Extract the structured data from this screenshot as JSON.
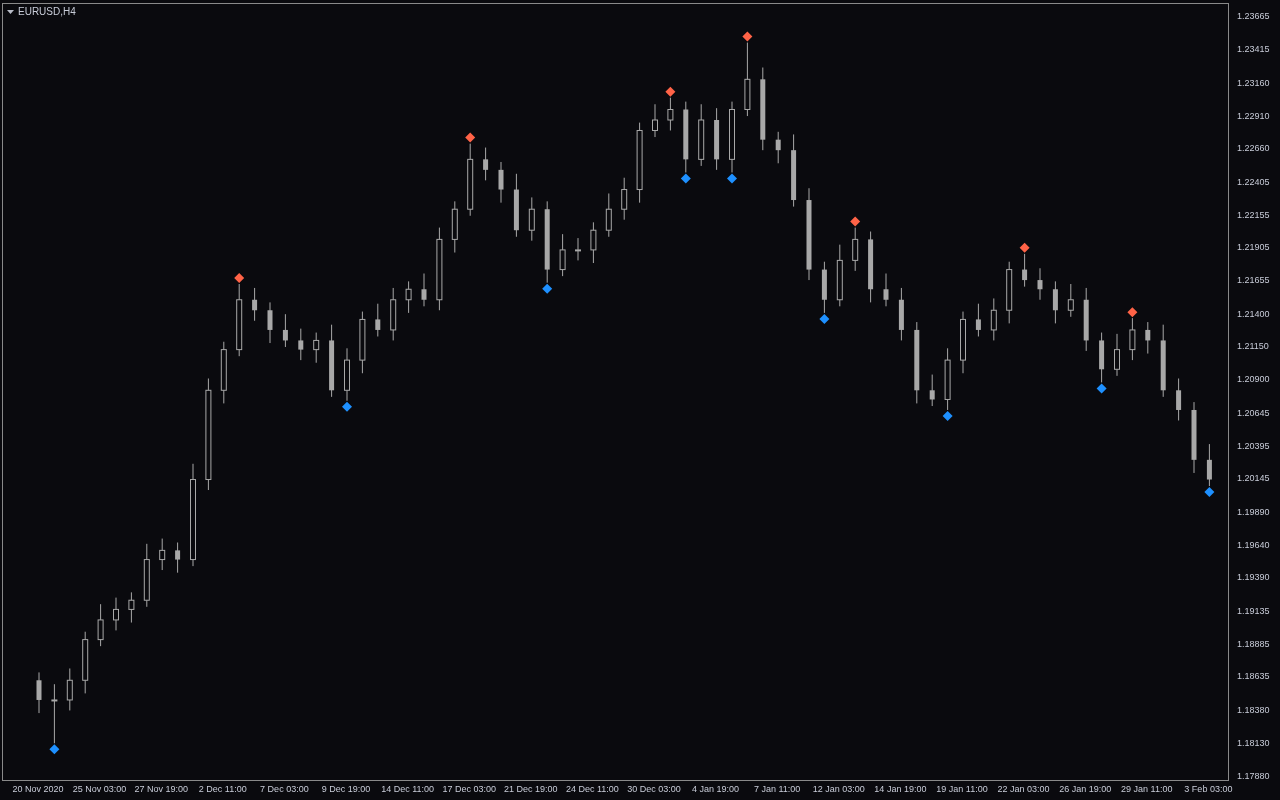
{
  "chart": {
    "chart_data": {
      "type": "candlestick",
      "title": "EURUSD,H4",
      "ylim": [
        1.1785,
        1.23764
      ],
      "yticks": [
        {
          "value": 1.23665,
          "label": "1.23665"
        },
        {
          "value": 1.23415,
          "label": "1.23415"
        },
        {
          "value": 1.2316,
          "label": "1.23160"
        },
        {
          "value": 1.2291,
          "label": "1.22910"
        },
        {
          "value": 1.2266,
          "label": "1.22660"
        },
        {
          "value": 1.22405,
          "label": "1.22405"
        },
        {
          "value": 1.22155,
          "label": "1.22155"
        },
        {
          "value": 1.21905,
          "label": "1.21905"
        },
        {
          "value": 1.21655,
          "label": "1.21655"
        },
        {
          "value": 1.214,
          "label": "1.21400"
        },
        {
          "value": 1.2115,
          "label": "1.21150"
        },
        {
          "value": 1.209,
          "label": "1.20900"
        },
        {
          "value": 1.20645,
          "label": "1.20645"
        },
        {
          "value": 1.20395,
          "label": "1.20395"
        },
        {
          "value": 1.20145,
          "label": "1.20145"
        },
        {
          "value": 1.1989,
          "label": "1.19890"
        },
        {
          "value": 1.1964,
          "label": "1.19640"
        },
        {
          "value": 1.1939,
          "label": "1.19390"
        },
        {
          "value": 1.19135,
          "label": "1.19135"
        },
        {
          "value": 1.18885,
          "label": "1.18885"
        },
        {
          "value": 1.18635,
          "label": "1.18635"
        },
        {
          "value": 1.1838,
          "label": "1.18380"
        },
        {
          "value": 1.1813,
          "label": "1.18130"
        },
        {
          "value": 1.1788,
          "label": "1.17880"
        }
      ],
      "categories": [
        "20 Nov 2020",
        null,
        null,
        null,
        "25 Nov 03:00",
        null,
        null,
        null,
        "27 Nov 19:00",
        null,
        null,
        null,
        "2 Dec 11:00",
        null,
        null,
        null,
        "7 Dec 03:00",
        null,
        null,
        null,
        "9 Dec 19:00",
        null,
        null,
        null,
        "14 Dec 11:00",
        null,
        null,
        null,
        "17 Dec 03:00",
        null,
        null,
        null,
        "21 Dec 19:00",
        null,
        null,
        null,
        "24 Dec 11:00",
        null,
        null,
        null,
        "30 Dec 03:00",
        null,
        null,
        null,
        "4 Jan 19:00",
        null,
        null,
        null,
        "7 Jan 11:00",
        null,
        null,
        null,
        "12 Jan 03:00",
        null,
        null,
        null,
        "14 Jan 19:00",
        null,
        null,
        null,
        "19 Jan 11:00",
        null,
        null,
        null,
        "22 Jan 03:00",
        null,
        null,
        null,
        "26 Jan 19:00",
        null,
        null,
        null,
        "29 Jan 11:00",
        null,
        null,
        null,
        "3 Feb 03:00"
      ],
      "series": [
        {
          "color": "#a8a8a8",
          "ohlc": [
            [
              1.1861,
              1.1867,
              1.1836,
              1.1846
            ],
            [
              1.1846,
              1.1858,
              1.1813,
              1.1846
            ],
            [
              1.1846,
              1.187,
              1.1838,
              1.1861
            ],
            [
              1.1861,
              1.1898,
              1.1851,
              1.1892
            ],
            [
              1.1892,
              1.1919,
              1.1887,
              1.1907
            ],
            [
              1.1907,
              1.1924,
              1.1899,
              1.1915
            ],
            [
              1.1915,
              1.1928,
              1.1905,
              1.1922
            ],
            [
              1.1922,
              1.1965,
              1.1917,
              1.1953
            ],
            [
              1.1953,
              1.1969,
              1.1945,
              1.196
            ],
            [
              1.196,
              1.1966,
              1.1943,
              1.1953
            ],
            [
              1.1953,
              1.2026,
              1.1948,
              1.2014
            ],
            [
              1.2014,
              1.2091,
              1.2006,
              1.2082
            ],
            [
              1.2082,
              1.2119,
              1.2072,
              1.2113
            ],
            [
              1.2113,
              1.2163,
              1.2108,
              1.2151
            ],
            [
              1.2151,
              1.216,
              1.2135,
              1.2143
            ],
            [
              1.2143,
              1.2149,
              1.2118,
              1.2128
            ],
            [
              1.2128,
              1.214,
              1.2115,
              1.212
            ],
            [
              1.212,
              1.2129,
              1.2105,
              1.2113
            ],
            [
              1.2113,
              1.2126,
              1.2103,
              1.212
            ],
            [
              1.212,
              1.2132,
              1.2077,
              1.2082
            ],
            [
              1.2082,
              1.2114,
              1.2074,
              1.2105
            ],
            [
              1.2105,
              1.2142,
              1.2095,
              1.2136
            ],
            [
              1.2136,
              1.2148,
              1.2123,
              1.2128
            ],
            [
              1.2128,
              1.216,
              1.212,
              1.2151
            ],
            [
              1.2151,
              1.2165,
              1.2141,
              1.2159
            ],
            [
              1.2159,
              1.2171,
              1.2146,
              1.2151
            ],
            [
              1.2151,
              1.2206,
              1.2143,
              1.2197
            ],
            [
              1.2197,
              1.2226,
              1.2187,
              1.222
            ],
            [
              1.222,
              1.227,
              1.2215,
              1.2258
            ],
            [
              1.2258,
              1.2267,
              1.2242,
              1.225
            ],
            [
              1.225,
              1.2256,
              1.2225,
              1.2235
            ],
            [
              1.2235,
              1.2247,
              1.2199,
              1.2204
            ],
            [
              1.2204,
              1.2229,
              1.2196,
              1.222
            ],
            [
              1.222,
              1.2226,
              1.2164,
              1.2174
            ],
            [
              1.2174,
              1.2201,
              1.2169,
              1.2189
            ],
            [
              1.2189,
              1.2198,
              1.2181,
              1.2189
            ],
            [
              1.2189,
              1.221,
              1.2179,
              1.2204
            ],
            [
              1.2204,
              1.2232,
              1.2199,
              1.222
            ],
            [
              1.222,
              1.2244,
              1.2212,
              1.2235
            ],
            [
              1.2235,
              1.2286,
              1.2225,
              1.228
            ],
            [
              1.228,
              1.23,
              1.2275,
              1.2288
            ],
            [
              1.2288,
              1.2305,
              1.228,
              1.2296
            ],
            [
              1.2296,
              1.2302,
              1.2248,
              1.2258
            ],
            [
              1.2258,
              1.23,
              1.2253,
              1.2288
            ],
            [
              1.2288,
              1.2297,
              1.225,
              1.2258
            ],
            [
              1.2258,
              1.2302,
              1.2248,
              1.2296
            ],
            [
              1.2296,
              1.2347,
              1.2291,
              1.2319
            ],
            [
              1.2319,
              1.2328,
              1.2265,
              1.2273
            ],
            [
              1.2273,
              1.2279,
              1.2255,
              1.2265
            ],
            [
              1.2265,
              1.2277,
              1.2222,
              1.2227
            ],
            [
              1.2227,
              1.2236,
              1.2166,
              1.2174
            ],
            [
              1.2174,
              1.218,
              1.2141,
              1.2151
            ],
            [
              1.2151,
              1.2193,
              1.2146,
              1.2181
            ],
            [
              1.2181,
              1.2206,
              1.2173,
              1.2197
            ],
            [
              1.2197,
              1.2203,
              1.2149,
              1.2159
            ],
            [
              1.2159,
              1.2171,
              1.2146,
              1.2151
            ],
            [
              1.2151,
              1.216,
              1.212,
              1.2128
            ],
            [
              1.2128,
              1.2134,
              1.2072,
              1.2082
            ],
            [
              1.2082,
              1.2094,
              1.207,
              1.2075
            ],
            [
              1.2075,
              1.2114,
              1.2067,
              1.2105
            ],
            [
              1.2105,
              1.2142,
              1.2095,
              1.2136
            ],
            [
              1.2136,
              1.2148,
              1.2123,
              1.2128
            ],
            [
              1.2128,
              1.2152,
              1.212,
              1.2143
            ],
            [
              1.2143,
              1.218,
              1.2133,
              1.2174
            ],
            [
              1.2174,
              1.2186,
              1.2161,
              1.2166
            ],
            [
              1.2166,
              1.2175,
              1.2151,
              1.2159
            ],
            [
              1.2159,
              1.2165,
              1.2133,
              1.2143
            ],
            [
              1.2143,
              1.2163,
              1.2138,
              1.2151
            ],
            [
              1.2151,
              1.216,
              1.2112,
              1.212
            ],
            [
              1.212,
              1.2126,
              1.2088,
              1.2098
            ],
            [
              1.2098,
              1.2125,
              1.2093,
              1.2113
            ],
            [
              1.2113,
              1.2137,
              1.2105,
              1.2128
            ],
            [
              1.2128,
              1.2134,
              1.211,
              1.212
            ],
            [
              1.212,
              1.2132,
              1.2077,
              1.2082
            ],
            [
              1.2082,
              1.2091,
              1.2059,
              1.2067
            ],
            [
              1.2067,
              1.2073,
              1.2019,
              1.2029
            ],
            [
              1.2029,
              1.2041,
              1.2009,
              1.2014
            ]
          ]
        }
      ]
    }
  }
}
